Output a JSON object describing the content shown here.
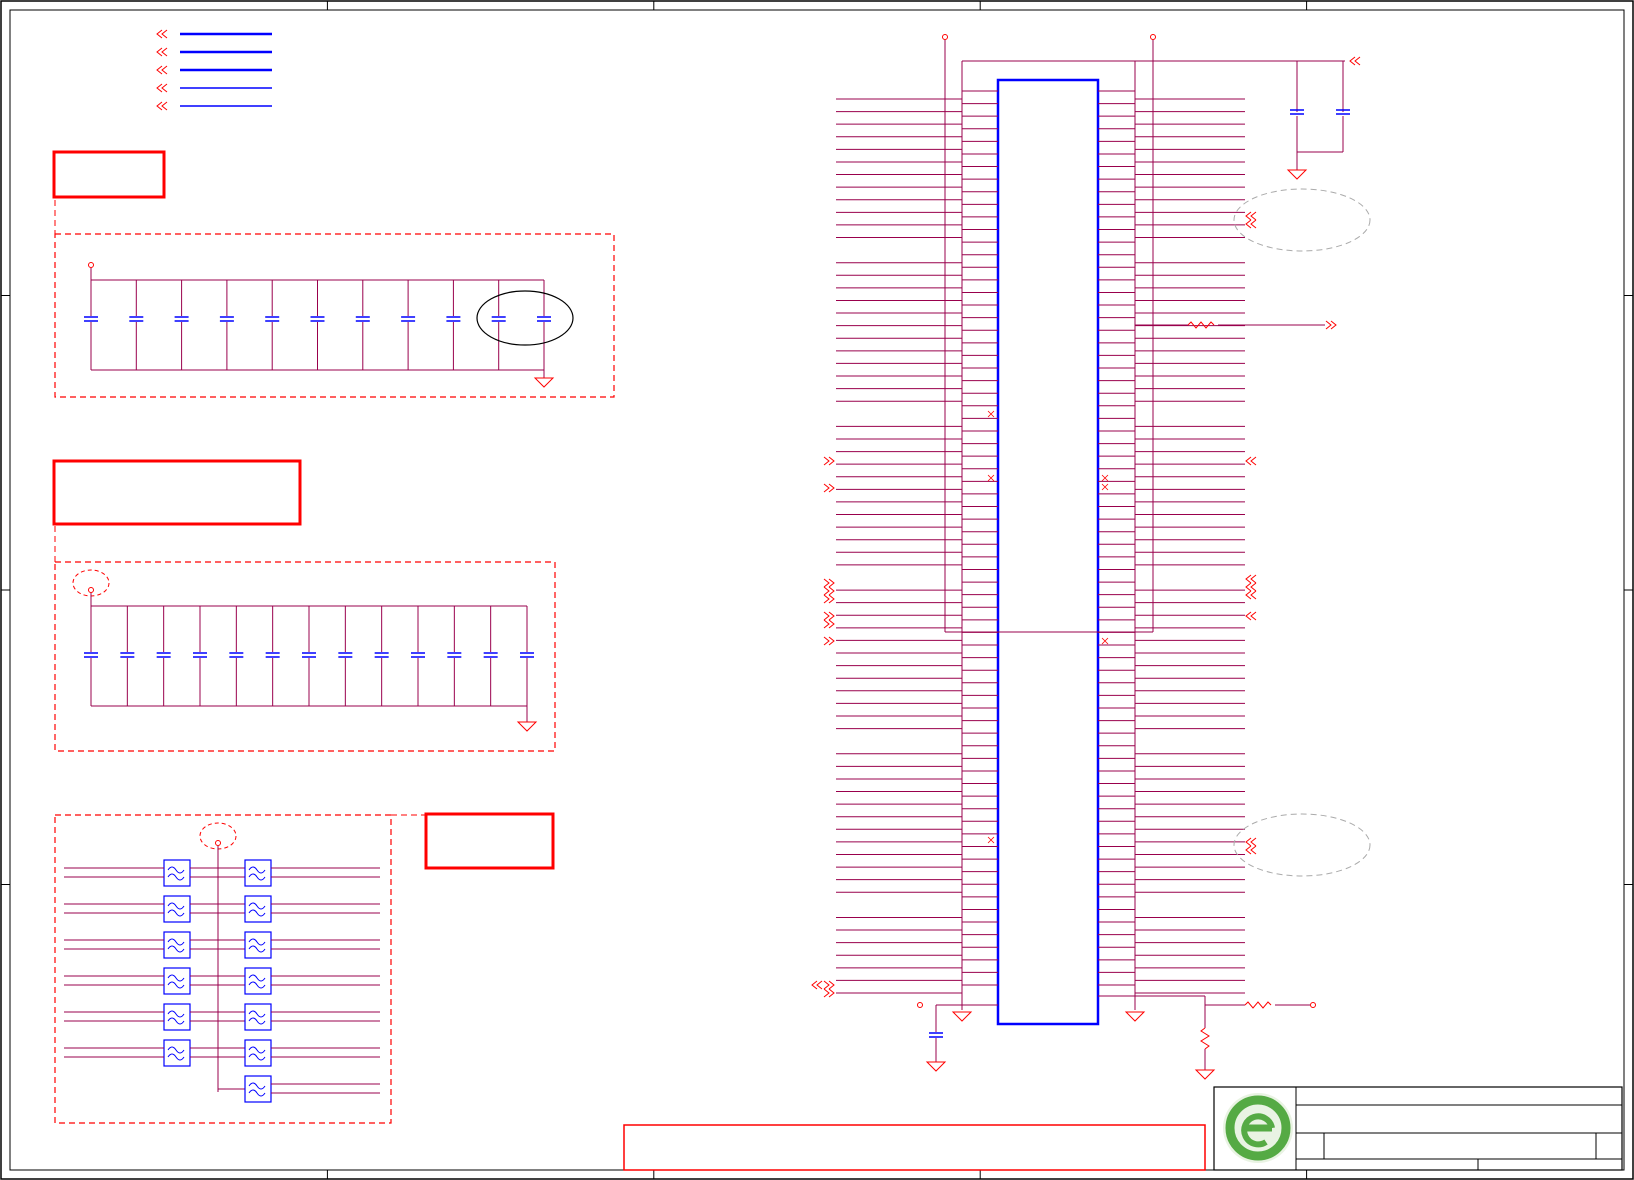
{
  "colors": {
    "border": "#000000",
    "net": "#99004c",
    "component": "#0000ff",
    "annotation": "#ff0000",
    "bus": "#0000ff",
    "logo_green": "#55aa44"
  },
  "sheet": {
    "zone_columns": 5,
    "zone_rows": 4
  },
  "connector": {
    "left_pins": 72,
    "right_pins": 72
  },
  "decoupling": {
    "group_top_caps": 11,
    "group_mid_caps": 13
  },
  "filters": {
    "left_column": 6,
    "right_column": 7
  },
  "title_block": {
    "logo": "company-logo"
  }
}
